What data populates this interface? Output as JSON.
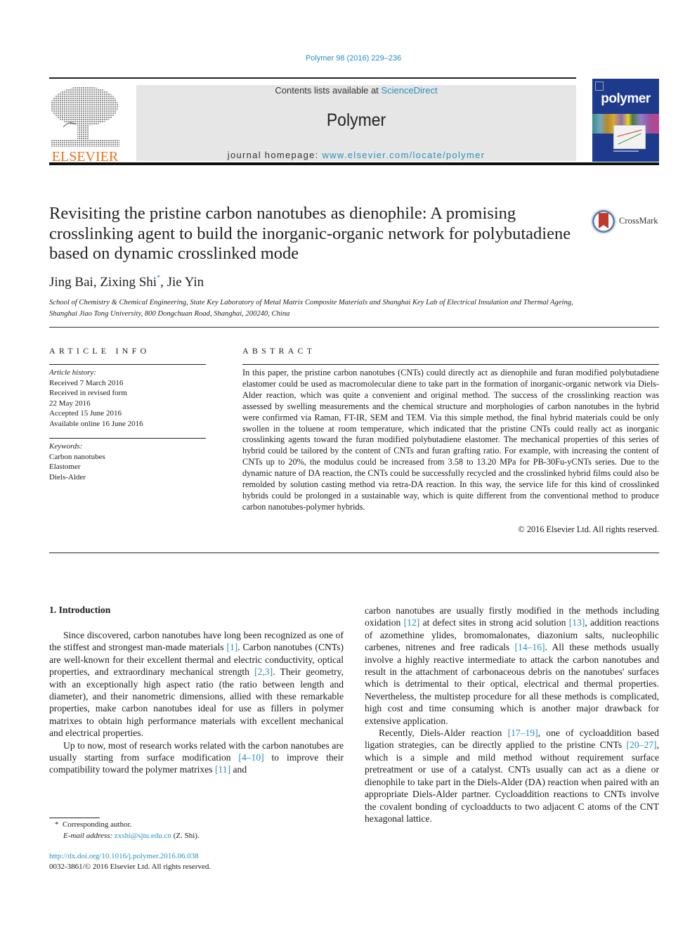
{
  "header": {
    "journal_ref": "Polymer 98 (2016) 229–236",
    "contents_prefix": "Contents lists available at ",
    "contents_link": "ScienceDirect",
    "journal_title": "Polymer",
    "homepage_prefix": "journal homepage: ",
    "homepage_link": "www.elsevier.com/locate/polymer",
    "publisher_logo_text": "ELSEVIER",
    "cover_title": "polymer",
    "colors": {
      "link": "#2a8fc1",
      "publisher": "#e8731e",
      "cover": "#1e3a8c",
      "box": "#e6e6e6"
    }
  },
  "article": {
    "title": "Revisiting the pristine carbon nanotubes as dienophile: A promising crosslinking agent to build the inorganic-organic network for polybutadiene based on dynamic crosslinked mode",
    "crossmark_label": "CrossMark",
    "authors": [
      {
        "name": "Jing Bai",
        "sep": ", "
      },
      {
        "name": "Zixing Shi",
        "mark": "*",
        "sep": ", "
      },
      {
        "name": "Jie Yin",
        "sep": ""
      }
    ],
    "affiliation": "School of Chemistry & Chemical Engineering, State Key Laboratory of Metal Matrix Composite Materials and Shanghai Key Lab of Electrical Insulation and Thermal Ageing, Shanghai Jiao Tong University, 800 Dongchuan Road, Shanghai, 200240, China"
  },
  "article_info": {
    "heading": "ARTICLE INFO",
    "history_label": "Article history:",
    "history": [
      "Received 7 March 2016",
      "Received in revised form",
      "22 May 2016",
      "Accepted 15 June 2016",
      "Available online 16 June 2016"
    ],
    "keywords_label": "Keywords:",
    "keywords": [
      "Carbon nanotubes",
      "Elastomer",
      "Diels-Alder"
    ]
  },
  "abstract": {
    "heading": "ABSTRACT",
    "text": "In this paper, the pristine carbon nanotubes (CNTs) could directly act as dienophile and furan modified polybutadiene elastomer could be used as macromolecular diene to take part in the formation of inorganic-organic network via Diels-Alder reaction, which was quite a convenient and original method. The success of the crosslinking reaction was assessed by swelling measurements and the chemical structure and morphologies of carbon nanotubes in the hybrid were confirmed via Raman, FT-IR, SEM and TEM. Via this simple method, the final hybrid materials could be only swollen in the toluene at room temperature, which indicated that the pristine CNTs could really act as inorganic crosslinking agents toward the furan modified polybutadiene elastomer. The mechanical properties of this series of hybrid could be tailored by the content of CNTs and furan grafting ratio. For example, with increasing the content of CNTs up to 20%, the modulus could be increased from 3.58 to 13.20 MPa for PB-30Fu-yCNTs series. Due to the dynamic nature of DA reaction, the CNTs could be successfully recycled and the crosslinked hybrid films could also be remolded by solution casting method via retra-DA reaction. In this way, the service life for this kind of crosslinked hybrids could be prolonged in a sustainable way, which is quite different from the conventional method to produce carbon nanotubes-polymer hybrids.",
    "copyright": "© 2016 Elsevier Ltd. All rights reserved."
  },
  "body": {
    "section_heading": "1.  Introduction",
    "left_paragraphs": [
      [
        {
          "t": "Since discovered, carbon nanotubes have long been recognized as one of the stiffest and strongest man-made materials "
        },
        {
          "ref": "[1]"
        },
        {
          "t": ". Carbon nanotubes (CNTs) are well-known for their excellent thermal and electric conductivity, optical properties, and extraordinary mechanical strength "
        },
        {
          "ref": "[2,3]"
        },
        {
          "t": ". Their geometry, with an exceptionally high aspect ratio (the ratio between length and diameter), and their nanometric dimensions, allied with these remarkable properties, make carbon nanotubes ideal for use as fillers in polymer matrixes to obtain high performance materials with excellent mechanical and electrical properties."
        }
      ],
      [
        {
          "t": "Up to now, most of research works related with the carbon nanotubes are usually starting from surface modification "
        },
        {
          "ref": "[4–10]"
        },
        {
          "t": " to improve their compatibility toward the polymer matrixes "
        },
        {
          "ref": "[11]"
        },
        {
          "t": " and"
        }
      ]
    ],
    "right_paragraphs": [
      [
        {
          "t": "carbon nanotubes are usually firstly modified in the methods including oxidation "
        },
        {
          "ref": "[12]"
        },
        {
          "t": " at defect sites in strong acid solution "
        },
        {
          "ref": "[13]"
        },
        {
          "t": ", addition reactions of azomethine ylides, bromomalonates, diazonium salts, nucleophilic carbenes, nitrenes and free radicals "
        },
        {
          "ref": "[14–16]"
        },
        {
          "t": ". All these methods usually involve a highly reactive intermediate to attack the carbon nanotubes and result in the attachment of carbonaceous debris on the nanotubes' surfaces which is detrimental to their optical, electrical and thermal properties. Nevertheless, the multistep procedure for all these methods is complicated, high cost and time consuming which is another major drawback for extensive application."
        }
      ],
      [
        {
          "t": "Recently, Diels-Alder reaction "
        },
        {
          "ref": "[17–19]"
        },
        {
          "t": ", one of cycloaddition based ligation strategies, can be directly applied to the pristine CNTs "
        },
        {
          "ref": "[20–27]"
        },
        {
          "t": ", which is a simple and mild method without requirement surface pretreatment or use of a catalyst. CNTs usually can act as a diene or dienophile to take part in the Diels-Alder (DA) reaction when paired with an appropriate Diels-Alder partner. Cycloaddition reactions to CNTs involve the covalent bonding of cycloadducts to two adjacent C atoms of the CNT hexagonal lattice."
        }
      ]
    ]
  },
  "footer": {
    "footnote_mark": "*",
    "footnote_text": "Corresponding author.",
    "email_label": "E-mail address:",
    "email": "zxshi@sjtu.edu.cn",
    "email_suffix": " (Z. Shi).",
    "doi": "http://dx.doi.org/10.1016/j.polymer.2016.06.038",
    "issn_line": "0032-3861/© 2016 Elsevier Ltd. All rights reserved."
  }
}
